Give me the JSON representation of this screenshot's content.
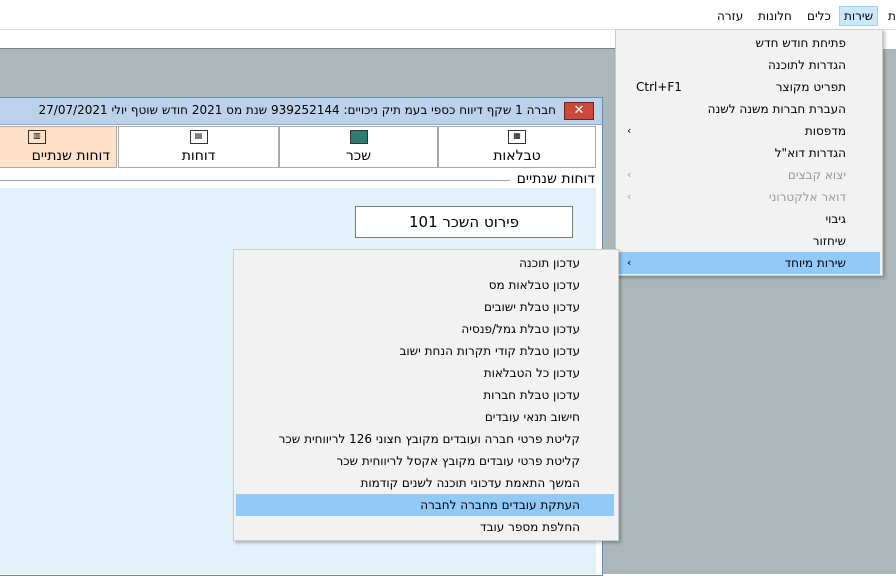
{
  "menubar": {
    "items": [
      {
        "label": "ת"
      },
      {
        "label": "שירות"
      },
      {
        "label": "כלים"
      },
      {
        "label": "חלונות"
      },
      {
        "label": "עזרה"
      }
    ]
  },
  "child_window": {
    "title": "חברה 1 שקף דיווח כספי בעמ  תיק ניכויים: 939252144  שנת מס 2021  חודש שוטף יולי   27/07/2021",
    "close_glyph": "✕",
    "tabs": [
      {
        "label": "טבלאות"
      },
      {
        "label": "שכר"
      },
      {
        "label": "דוחות"
      },
      {
        "label": "דוחות שנתיים"
      }
    ],
    "section_title": "דוחות שנתיים",
    "button_label": "פירוט השכר 101"
  },
  "service_menu": {
    "items": [
      {
        "label": "פתיחת חודש חדש"
      },
      {
        "label": "הגדרות לתוכנה"
      },
      {
        "label": "תפריט מקוצר",
        "shortcut": "Ctrl+F1"
      },
      {
        "label": "העברת חברות משנה לשנה"
      },
      {
        "label": "מדפסות",
        "arrow": "›"
      },
      {
        "label": "הגדרות דוא\"ל"
      },
      {
        "label": "יצוא קבצים",
        "arrow": "›"
      },
      {
        "label": "דואר אלקטרוני",
        "arrow": "›"
      },
      {
        "label": "גיבוי"
      },
      {
        "label": "שיחזור"
      },
      {
        "label": "שירות מיוחד",
        "arrow": "›"
      }
    ]
  },
  "special_submenu": {
    "items": [
      {
        "label": "עדכון תוכנה"
      },
      {
        "label": "עדכון טבלאות מס"
      },
      {
        "label": "עדכון טבלת ישובים"
      },
      {
        "label": "עדכון טבלת גמל/פנסיה"
      },
      {
        "label": "עדכון טבלת קודי תקרות הנחת ישוב"
      },
      {
        "label": "עדכון כל הטבלאות"
      },
      {
        "label": "עדכון טבלת חברות"
      },
      {
        "label": "חישוב תנאי עובדים"
      },
      {
        "label": "קליטת פרטי חברה ועובדים מקובץ חצוני 126 לריווחית שכר"
      },
      {
        "label": "קליטת פרטי עובדים מקובץ אקסל לריווחית שכר"
      },
      {
        "label": "המשך התאמת עדכוני תוכנה לשנים קודמות"
      },
      {
        "label": "העתקת עובדים מחברה לחברה"
      },
      {
        "label": "החלפת מספר עובד"
      }
    ]
  }
}
